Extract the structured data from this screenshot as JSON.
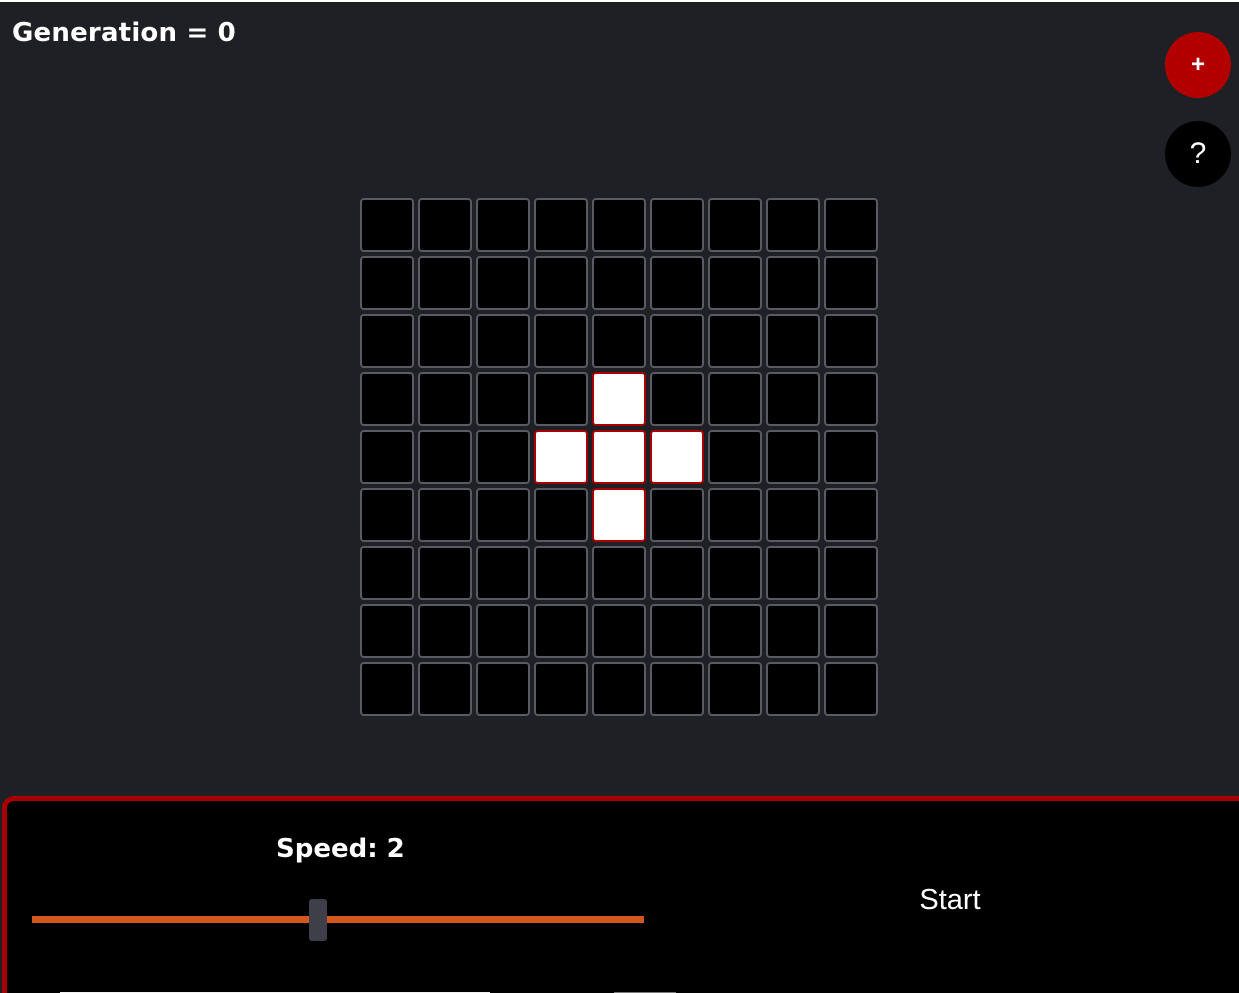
{
  "header": {
    "generation_label": "Generation = 0"
  },
  "fabs": {
    "add_label": "+",
    "help_label": "?"
  },
  "grid": {
    "rows": 9,
    "cols": 9,
    "alive": [
      [
        3,
        4
      ],
      [
        4,
        3
      ],
      [
        4,
        4
      ],
      [
        4,
        5
      ],
      [
        5,
        4
      ]
    ]
  },
  "controls": {
    "speed_label": "Speed: 2",
    "speed_fraction": 0.467,
    "start_label": "Start"
  },
  "colors": {
    "background": "#1f2025",
    "accent_red": "#b20000",
    "slider_orange": "#d2561e",
    "cell_dead": "#000000",
    "cell_alive": "#ffffff",
    "cell_border": "#595a63"
  }
}
